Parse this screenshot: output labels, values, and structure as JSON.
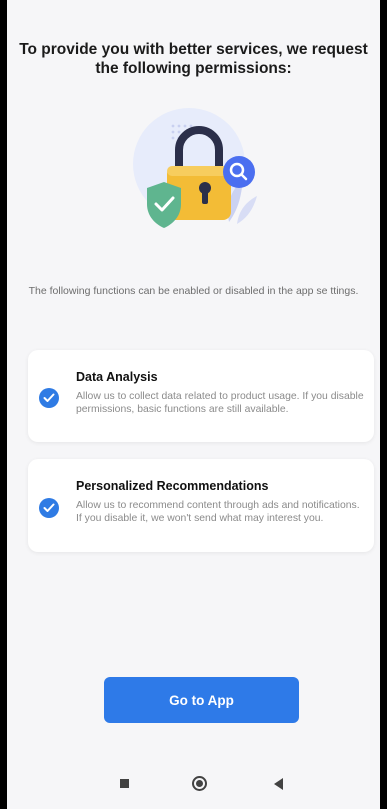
{
  "header": {
    "title": "To provide you with better services, we request the following permissions:"
  },
  "illustration": {
    "icon": "padlock-shield-search-illustration"
  },
  "description": "The following functions can be enabled or disabled in the app se ttings.",
  "permissions": [
    {
      "title": "Data Analysis",
      "description": "Allow us to collect data related to product usage. If you disable permissions, basic functions are still available.",
      "checked": true
    },
    {
      "title": "Personalized Recommendations",
      "description": "Allow us to recommend content through ads and notifications. If you disable it, we won't send what may interest you.",
      "checked": true
    }
  ],
  "cta": {
    "label": "Go to App"
  },
  "navbar": {
    "recents_icon": "square-icon",
    "home_icon": "circle-icon",
    "back_icon": "triangle-back-icon"
  },
  "colors": {
    "accent": "#2e7ae8",
    "background": "#f6f6f8",
    "lock_body": "#f3bc36",
    "shield": "#5fb58f"
  }
}
